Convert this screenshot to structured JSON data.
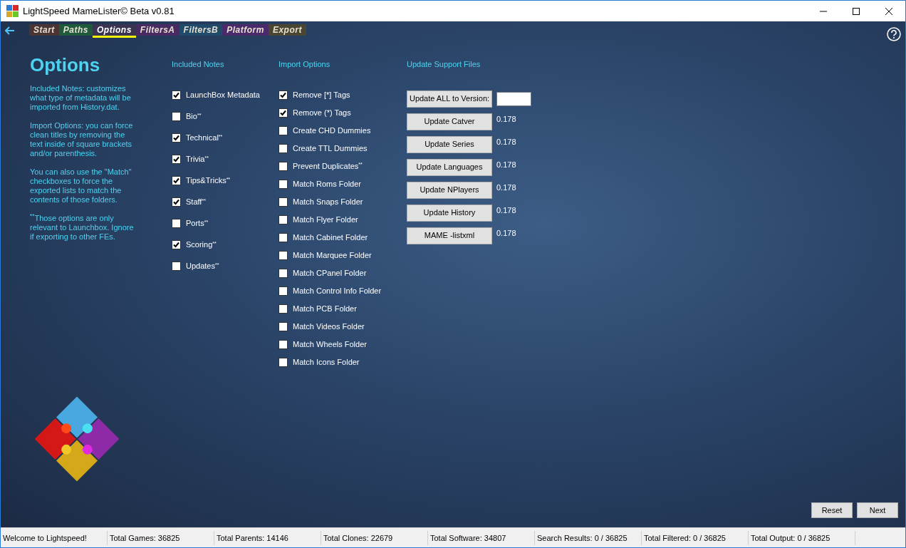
{
  "window": {
    "title": "LightSpeed MameLister© Beta v0.81"
  },
  "tabs": [
    {
      "label": "Start",
      "selected": false,
      "color": "#4a3434"
    },
    {
      "label": "Paths",
      "selected": false,
      "color": "#1f5a3c"
    },
    {
      "label": "Options",
      "selected": true,
      "color": "#3a3452"
    },
    {
      "label": "FiltersA",
      "selected": false,
      "color": "#4a2a62"
    },
    {
      "label": "FiltersB",
      "selected": false,
      "color": "#1f4a6a"
    },
    {
      "label": "Platform",
      "selected": false,
      "color": "#4a2a6a"
    },
    {
      "label": "Export",
      "selected": false,
      "color": "#4a4632"
    }
  ],
  "page_title": "Options",
  "help_paragraphs": [
    "Included Notes: customizes what type of metadata will be imported from History.dat.",
    "Import Options: you can force clean titles by removing the text inside of square brackets and/or parenthesis.",
    "You can also use the \"Match\" checkboxes to force the exported lists to match the contents of those folders.",
    "$^{**}$Those options are only relevant to Launchbox. Ignore if exporting to other FEs."
  ],
  "included_notes": {
    "heading": "Included Notes",
    "items": [
      {
        "label": "LaunchBox Metadata",
        "checked": true
      },
      {
        "label": "Bio$^{**}$",
        "checked": false
      },
      {
        "label": "Technical$^{**}$",
        "checked": true
      },
      {
        "label": "Trivia$^{**}$",
        "checked": true
      },
      {
        "label": "Tips&Tricks$^{**}$",
        "checked": true
      },
      {
        "label": "Staff$^{**}$",
        "checked": true
      },
      {
        "label": "Ports$^{**}$",
        "checked": false
      },
      {
        "label": "Scoring$^{**}$",
        "checked": true
      },
      {
        "label": "Updates$^{**}$",
        "checked": false
      }
    ]
  },
  "import_options": {
    "heading": "Import Options",
    "items": [
      {
        "label": "Remove [*] Tags",
        "checked": true
      },
      {
        "label": "Remove (*) Tags",
        "checked": true
      },
      {
        "label": "Create CHD Dummies",
        "checked": false
      },
      {
        "label": "Create TTL Dummies",
        "checked": false
      },
      {
        "label": "Prevent Duplicates$^{**}$",
        "checked": false
      },
      {
        "label": "Match Roms Folder",
        "checked": false
      },
      {
        "label": "Match Snaps Folder",
        "checked": false
      },
      {
        "label": "Match Flyer Folder",
        "checked": false
      },
      {
        "label": "Match Cabinet Folder",
        "checked": false
      },
      {
        "label": "Match Marquee Folder",
        "checked": false
      },
      {
        "label": "Match CPanel Folder",
        "checked": false
      },
      {
        "label": "Match Control Info Folder",
        "checked": false
      },
      {
        "label": "Match PCB Folder",
        "checked": false
      },
      {
        "label": "Match Videos Folder",
        "checked": false
      },
      {
        "label": "Match Wheels Folder",
        "checked": false
      },
      {
        "label": "Match Icons Folder",
        "checked": false
      }
    ]
  },
  "update_support_files": {
    "heading": "Update Support Files",
    "update_all": {
      "label": "Update ALL to Version:"
    },
    "items": [
      {
        "label": "Update Catver",
        "version": "0.178"
      },
      {
        "label": "Update Series",
        "version": "0.178"
      },
      {
        "label": "Update Languages",
        "version": "0.178"
      },
      {
        "label": "Update NPlayers",
        "version": "0.178"
      },
      {
        "label": "Update History",
        "version": "0.178"
      },
      {
        "label": "MAME -listxml",
        "version": "0.178"
      }
    ]
  },
  "buttons": [
    "Reset",
    "Next"
  ],
  "status_bar": [
    "Welcome to Lightspeed!",
    "Total Games: 36825",
    "Total Parents: 14146",
    "Total Clones: 22679",
    "Total Software: 34807",
    "Search Results: 0 / 36825",
    "Total Filtered: 0 / 36825",
    "Total Output: 0 / 36825"
  ]
}
